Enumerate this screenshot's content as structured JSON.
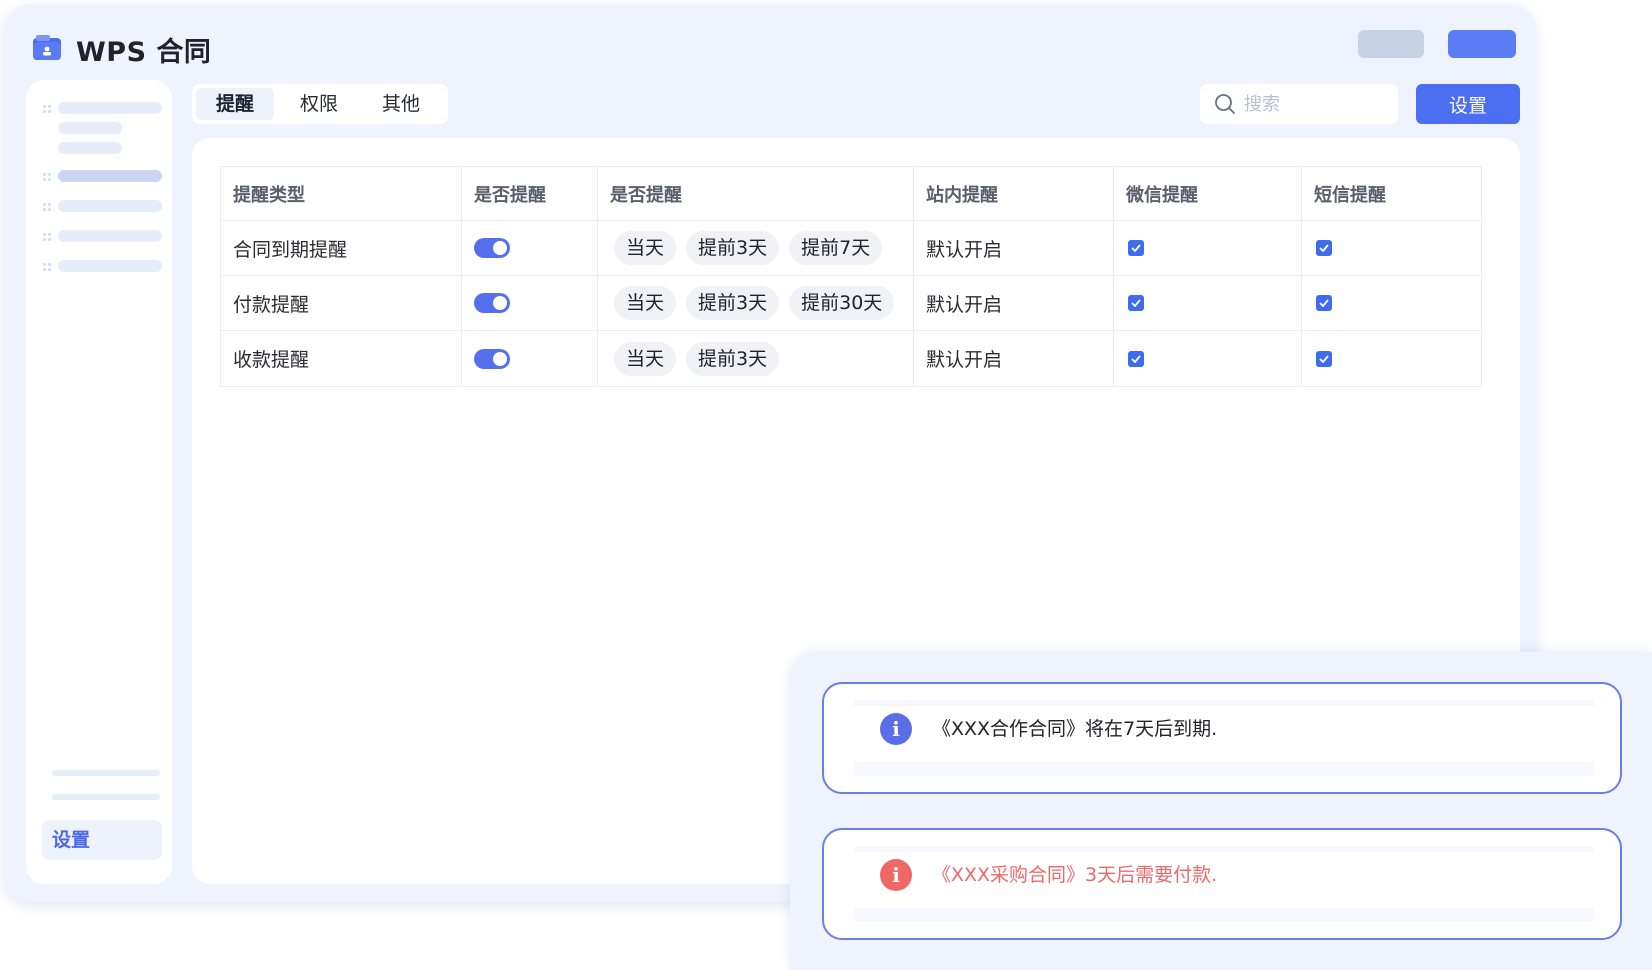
{
  "app": {
    "title": "WPS 合同"
  },
  "sidebar": {
    "settings_label": "设置"
  },
  "tabs": [
    {
      "label": "提醒",
      "active": true
    },
    {
      "label": "权限",
      "active": false
    },
    {
      "label": "其他",
      "active": false
    }
  ],
  "search": {
    "placeholder": "搜索"
  },
  "toolbar": {
    "settings_label": "设置"
  },
  "table": {
    "headers": [
      "提醒类型",
      "是否提醒",
      "是否提醒",
      "站内提醒",
      "微信提醒",
      "短信提醒"
    ],
    "rows": [
      {
        "type": "合同到期提醒",
        "enabled": true,
        "chips": [
          "当天",
          "提前3天",
          "提前7天"
        ],
        "in_app": "默认开启",
        "wechat": true,
        "sms": true
      },
      {
        "type": "付款提醒",
        "enabled": true,
        "chips": [
          "当天",
          "提前3天",
          "提前30天"
        ],
        "in_app": "默认开启",
        "wechat": true,
        "sms": true
      },
      {
        "type": "收款提醒",
        "enabled": true,
        "chips": [
          "当天",
          "提前3天"
        ],
        "in_app": "默认开启",
        "wechat": true,
        "sms": true
      }
    ]
  },
  "notifications": [
    {
      "kind": "info",
      "text": "《XXX合作合同》将在7天后到期."
    },
    {
      "kind": "warn",
      "text": "《XXX采购合同》3天后需要付款."
    }
  ],
  "colors": {
    "accent": "#4c6ef0",
    "warning": "#ef6868",
    "info": "#5a6ee8",
    "window_bg": "#eef3fd"
  }
}
